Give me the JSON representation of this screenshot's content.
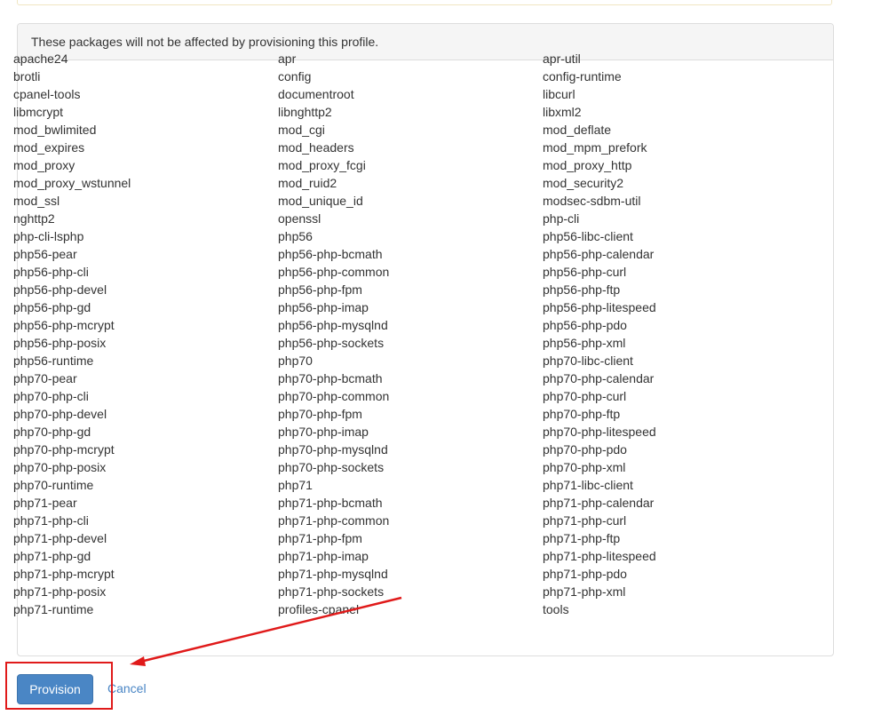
{
  "panel": {
    "heading": "These packages will not be affected by provisioning this profile."
  },
  "packages": [
    "apache24",
    "apr",
    "apr-util",
    "brotli",
    "config",
    "config-runtime",
    "cpanel-tools",
    "documentroot",
    "libcurl",
    "libmcrypt",
    "libnghttp2",
    "libxml2",
    "mod_bwlimited",
    "mod_cgi",
    "mod_deflate",
    "mod_expires",
    "mod_headers",
    "mod_mpm_prefork",
    "mod_proxy",
    "mod_proxy_fcgi",
    "mod_proxy_http",
    "mod_proxy_wstunnel",
    "mod_ruid2",
    "mod_security2",
    "mod_ssl",
    "mod_unique_id",
    "modsec-sdbm-util",
    "nghttp2",
    "openssl",
    "php-cli",
    "php-cli-lsphp",
    "php56",
    "php56-libc-client",
    "php56-pear",
    "php56-php-bcmath",
    "php56-php-calendar",
    "php56-php-cli",
    "php56-php-common",
    "php56-php-curl",
    "php56-php-devel",
    "php56-php-fpm",
    "php56-php-ftp",
    "php56-php-gd",
    "php56-php-imap",
    "php56-php-litespeed",
    "php56-php-mcrypt",
    "php56-php-mysqlnd",
    "php56-php-pdo",
    "php56-php-posix",
    "php56-php-sockets",
    "php56-php-xml",
    "php56-runtime",
    "php70",
    "php70-libc-client",
    "php70-pear",
    "php70-php-bcmath",
    "php70-php-calendar",
    "php70-php-cli",
    "php70-php-common",
    "php70-php-curl",
    "php70-php-devel",
    "php70-php-fpm",
    "php70-php-ftp",
    "php70-php-gd",
    "php70-php-imap",
    "php70-php-litespeed",
    "php70-php-mcrypt",
    "php70-php-mysqlnd",
    "php70-php-pdo",
    "php70-php-posix",
    "php70-php-sockets",
    "php70-php-xml",
    "php70-runtime",
    "php71",
    "php71-libc-client",
    "php71-pear",
    "php71-php-bcmath",
    "php71-php-calendar",
    "php71-php-cli",
    "php71-php-common",
    "php71-php-curl",
    "php71-php-devel",
    "php71-php-fpm",
    "php71-php-ftp",
    "php71-php-gd",
    "php71-php-imap",
    "php71-php-litespeed",
    "php71-php-mcrypt",
    "php71-php-mysqlnd",
    "php71-php-pdo",
    "php71-php-posix",
    "php71-php-sockets",
    "php71-php-xml",
    "php71-runtime",
    "profiles-cpanel",
    "tools"
  ],
  "actions": {
    "provision_label": "Provision",
    "cancel_label": "Cancel"
  },
  "colors": {
    "primary_button": "#4a86c5",
    "link": "#4a86c5",
    "annotation": "#e01a1a"
  }
}
